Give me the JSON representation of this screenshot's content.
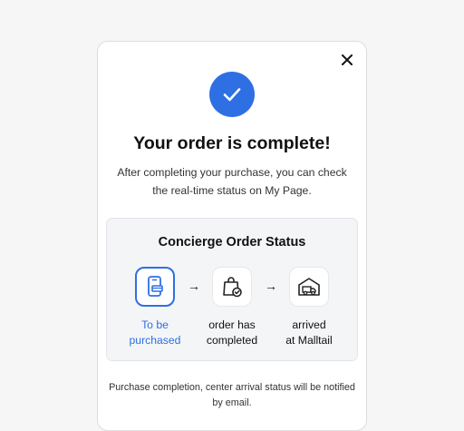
{
  "modal": {
    "close_icon": "close-icon",
    "success_icon": "checkmark-icon",
    "accent_color": "#2f6fe4",
    "title": "Your order is complete!",
    "description": "After completing your purchase, you can check the real-time status on My Page.",
    "status_panel": {
      "title": "Concierge Order Status",
      "steps": [
        {
          "label": "To be\npurchased",
          "icon": "phone-card-icon",
          "active": true
        },
        {
          "label": "order has\ncompleted",
          "icon": "shopping-bag-check-icon",
          "active": false
        },
        {
          "label": "arrived\nat Malltail",
          "icon": "warehouse-truck-icon",
          "active": false
        }
      ],
      "arrow_glyph": "→"
    },
    "footnote": "Purchase completion, center arrival status will be notified by email."
  }
}
